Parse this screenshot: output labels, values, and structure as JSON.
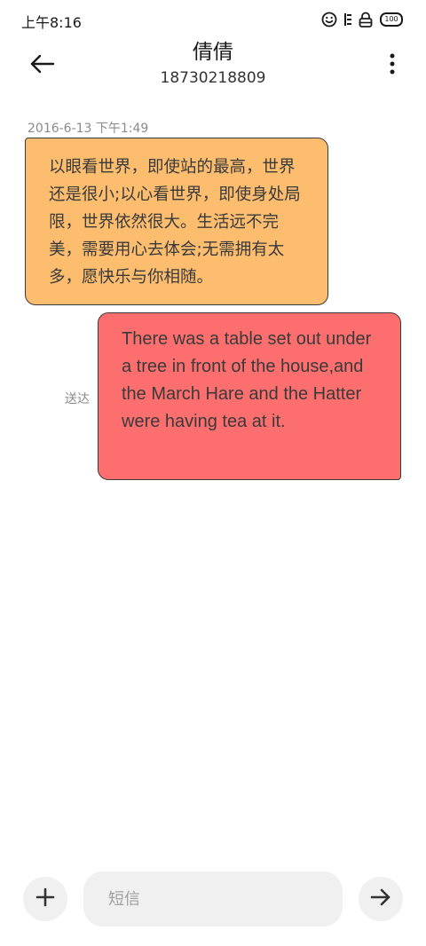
{
  "status_bar": {
    "time": "上午8:16",
    "battery": "100",
    "icons": [
      "smiley-icon",
      "vertical-bars-icon",
      "lock-icon",
      "battery-icon"
    ]
  },
  "header": {
    "contact_name": "倩倩",
    "contact_number": "18730218809",
    "back_icon": "back-arrow-icon",
    "more_icon": "more-vertical-icon"
  },
  "conversation": {
    "timestamp": "2016-6-13 下午1:49",
    "messages": [
      {
        "direction": "incoming",
        "text": "以眼看世界，即使站的最高，世界还是很小;以心看世界，即使身处局限，世界依然很大。生活远不完美，需要用心去体会;无需拥有太多，愿快乐与你相随。",
        "color": "#fdbd6f"
      },
      {
        "direction": "outgoing",
        "text": "There was a table set out under a tree in front of the house,and the March Hare and the Hatter were having tea at it.",
        "status": "送达",
        "color": "#fd6f6f"
      }
    ]
  },
  "composer": {
    "placeholder": "短信",
    "value": "",
    "add_icon": "plus-icon",
    "send_icon": "send-arrow-icon"
  }
}
